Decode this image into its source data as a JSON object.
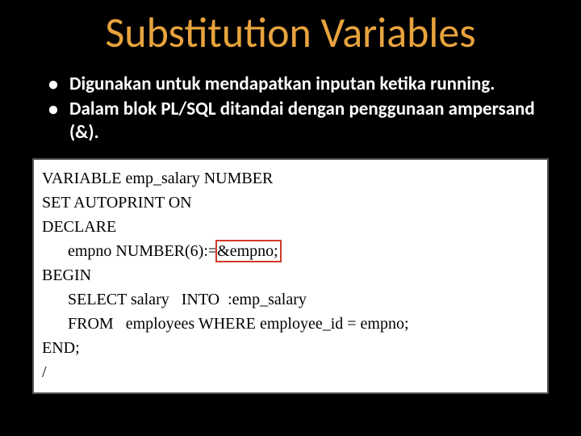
{
  "slide": {
    "title": "Substitution Variables",
    "bullets": [
      "Digunakan untuk mendapatkan inputan ketika running.",
      "Dalam blok PL/SQL ditandai dengan penggunaan ampersand (&)."
    ],
    "code": {
      "line1": "VARIABLE emp_salary NUMBER",
      "line2": "SET AUTOPRINT ON",
      "line3": "DECLARE",
      "line4_prefix": "empno NUMBER(6):=",
      "line4_highlight": "&empno;",
      "line5": "BEGIN",
      "line6": "SELECT salary   INTO  :emp_salary",
      "line7": "FROM   employees WHERE employee_id = empno;",
      "line8": "END;",
      "line9": "/"
    }
  }
}
